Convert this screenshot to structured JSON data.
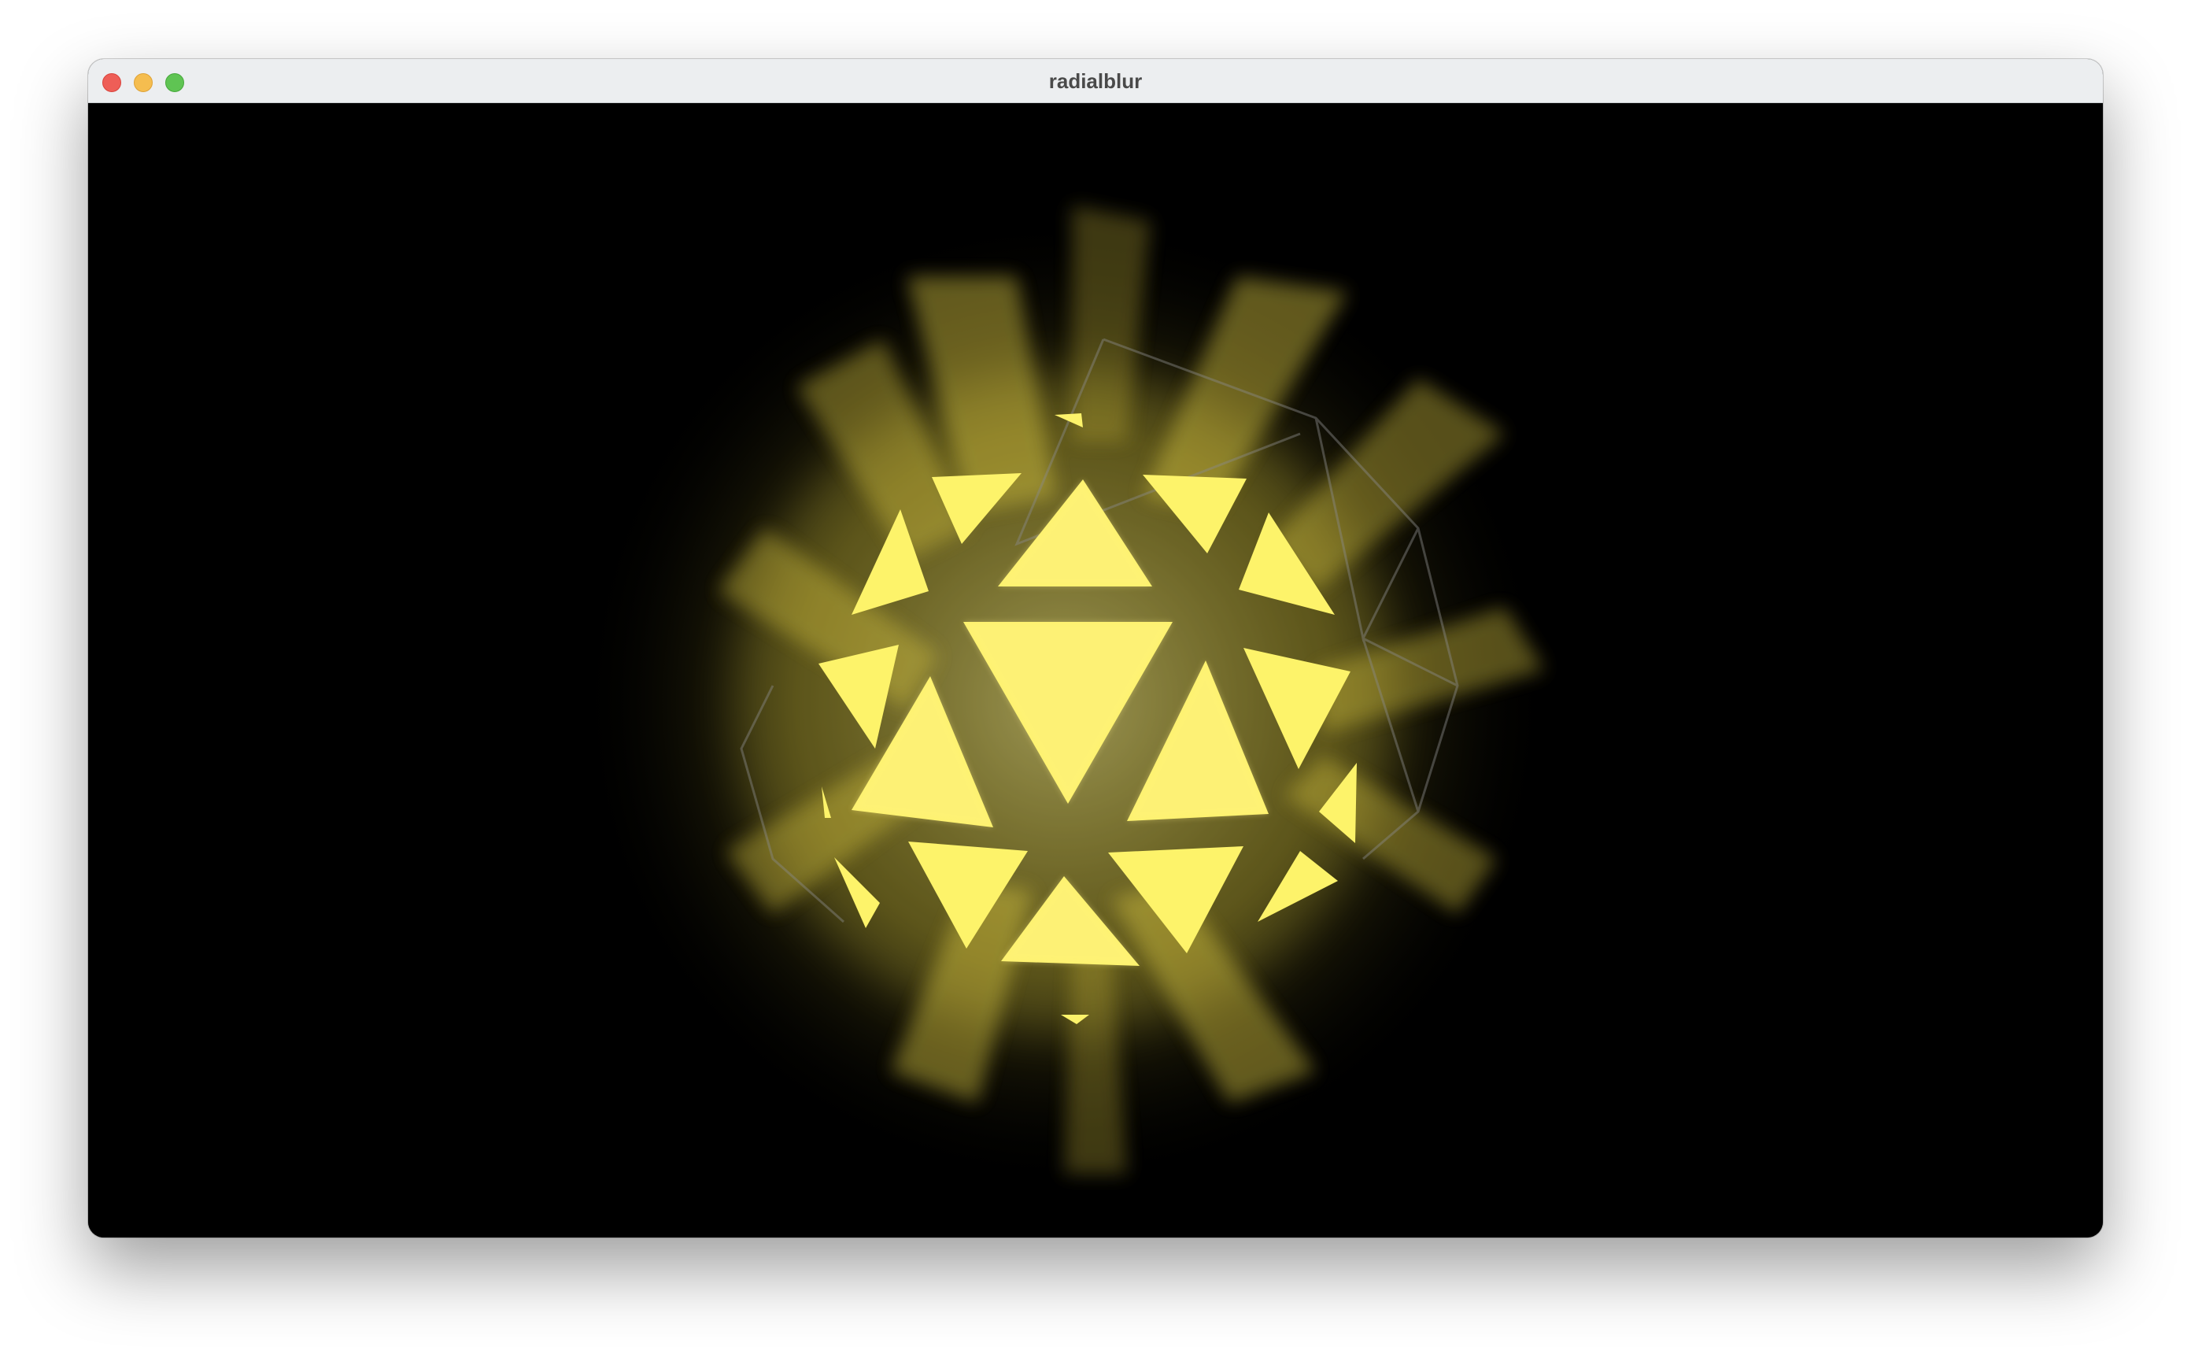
{
  "window": {
    "title": "radialblur"
  },
  "scene": {
    "background_color": "#000000",
    "face_color": "#fdf36a",
    "glow_color": "#e8d84a",
    "wireframe_color": "#8a8a8a",
    "object": "icosahedron-blur-render"
  }
}
